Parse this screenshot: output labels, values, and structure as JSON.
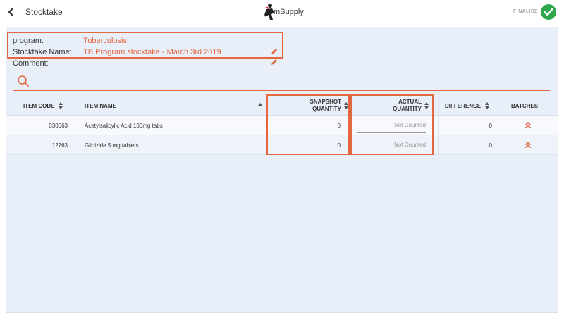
{
  "topbar": {
    "title": "Stocktake",
    "logo_text": "mSupply",
    "finalise_label": "FINALISE"
  },
  "form": {
    "program_label": "program:",
    "program_value": "Tuberculosis",
    "name_label": "Stocktake Name:",
    "name_value": "TB Program stocktake - March 3rd 2019",
    "comment_label": "Comment:",
    "comment_value": ""
  },
  "table": {
    "columns": {
      "item_code": "ITEM CODE",
      "item_name": "ITEM NAME",
      "snapshot_1": "SNAPSHOT",
      "snapshot_2": "QUANTITY",
      "actual_1": "ACTUAL",
      "actual_2": "QUANTITY",
      "difference": "DIFFERENCE",
      "batches": "BATCHES"
    },
    "rows": [
      {
        "code": "030063",
        "name": "Acetylsalicylic Acid 100mg tabs",
        "snapshot": "0",
        "actual": "Not Counted",
        "difference": "0"
      },
      {
        "code": "12763",
        "name": "Glipizide 5 mg tablets",
        "snapshot": "0",
        "actual": "Not Counted",
        "difference": "0"
      }
    ]
  },
  "colors": {
    "accent": "#e4673f",
    "success": "#2ea84a",
    "panel_bg": "#e8eff8"
  },
  "icons": [
    "back-icon",
    "check-icon",
    "pencil-icon",
    "search-icon",
    "sort-icon",
    "chevrons-up-icon"
  ]
}
